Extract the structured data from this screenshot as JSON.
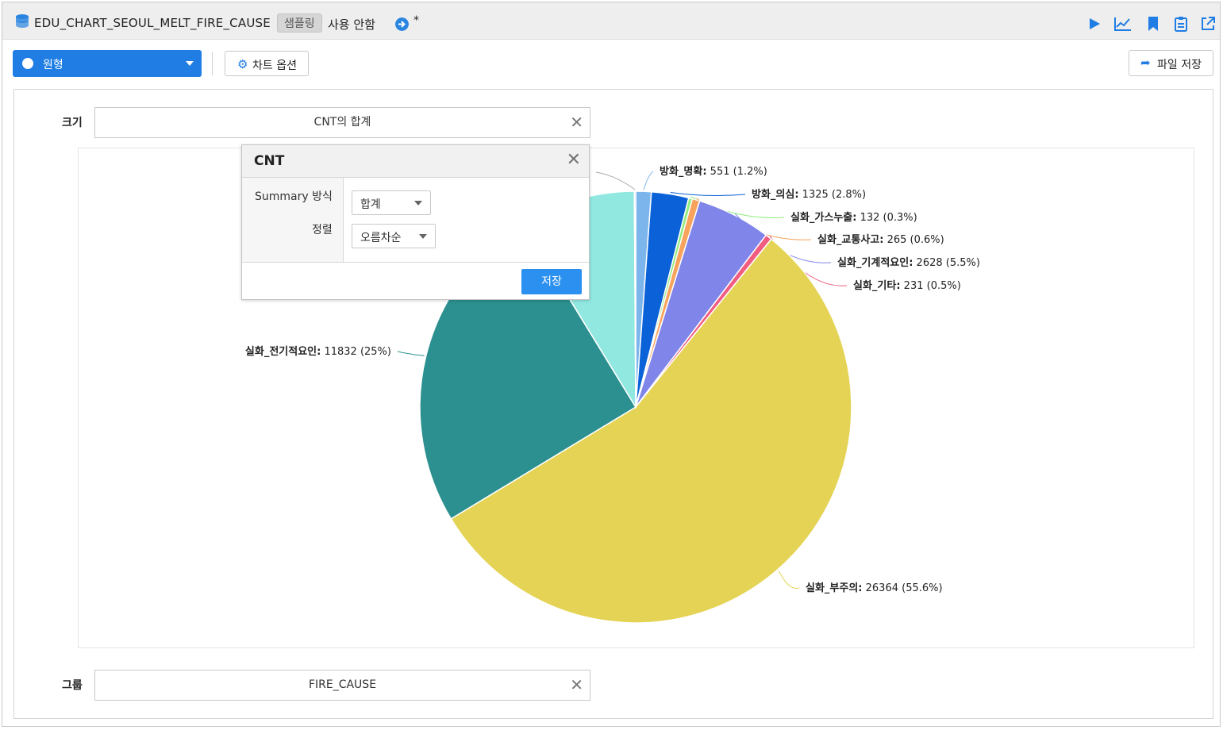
{
  "titlebar": {
    "table_name": "EDU_CHART_SEOUL_MELT_FIRE_CAUSE",
    "sampling_badge": "샘플링",
    "usage_guide": "사용 안함",
    "modified_mark": "*",
    "icons": [
      "database-icon",
      "arrow-right-circle-icon",
      "play-icon",
      "line-chart-icon",
      "bookmark-icon",
      "clipboard-icon",
      "export-icon"
    ]
  },
  "toolbar": {
    "chart_type": "원형",
    "chart_options": "차트 옵션",
    "save_file": "파일 저장",
    "accent": "#1f7de4"
  },
  "fields": {
    "size_label": "크기",
    "size_value": "CNT의 합계",
    "group_label": "그룹",
    "group_value": "FIRE_CAUSE"
  },
  "popup": {
    "title": "CNT",
    "summary_label": "Summary 방식",
    "summary_value": "합계",
    "sort_label": "정렬",
    "sort_value": "오름차순",
    "save": "저장"
  },
  "chart_data": {
    "type": "pie",
    "slices": [
      {
        "name": "방화_명확",
        "value": 551,
        "pct": "1.2%",
        "color": "#7cb5ec",
        "label": "방화_명확: 551 (1.2%)"
      },
      {
        "name": "방화_의심",
        "value": 1325,
        "pct": "2.8%",
        "color": "#0b62d8",
        "label": "방화_의심: 1325 (2.8%)"
      },
      {
        "name": "실화_가스누출",
        "value": 132,
        "pct": "0.3%",
        "color": "#90ed7d",
        "label": "실화_가스누출: 132 (0.3%)"
      },
      {
        "name": "실화_교통사고",
        "value": 265,
        "pct": "0.6%",
        "color": "#f7a35c",
        "label": "실화_교통사고: 265 (0.6%)"
      },
      {
        "name": "실화_기계적요인",
        "value": 2628,
        "pct": "5.5%",
        "color": "#8085e9",
        "label": "실화_기계적요인: 2628 (5.5%)"
      },
      {
        "name": "실화_기타",
        "value": 231,
        "pct": "0.5%",
        "color": "#f15c80",
        "label": "실화_기타: 231 (0.5%)"
      },
      {
        "name": "실화_부주의",
        "value": 26364,
        "pct": "55.6%",
        "color": "#e4d354",
        "label": "실화_부주의: 26364 (55.6%)"
      },
      {
        "name": "실화_전기적요인",
        "value": 11832,
        "pct": "25%",
        "color": "#2b908f",
        "label": "실화_전기적요인: 11832 (25%)"
      },
      {
        "name": "",
        "value": 4,
        "pct": "",
        "color": "#f45b5b",
        "label": ""
      },
      {
        "name": "",
        "value": 4100,
        "pct": "",
        "color": "#91e8e1",
        "label": ""
      },
      {
        "name": "",
        "value": 47,
        "pct": "0.1%",
        "color": "#aaaaaa",
        "label": "0.1%)"
      }
    ]
  }
}
